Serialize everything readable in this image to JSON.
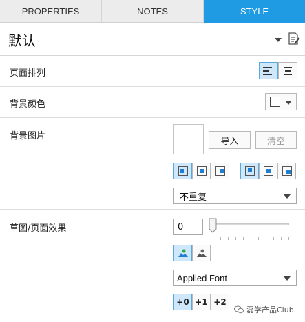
{
  "tabs": [
    {
      "label": "PROPERTIES",
      "active": false
    },
    {
      "label": "NOTES",
      "active": false
    },
    {
      "label": "STYLE",
      "active": true
    }
  ],
  "header": {
    "title": "默认"
  },
  "page_alignment": {
    "label": "页面排列",
    "options": [
      "align-left",
      "align-center"
    ],
    "selected": "align-left"
  },
  "bg_color": {
    "label": "背景颜色",
    "swatch": "#ffffff"
  },
  "bg_image": {
    "label": "背景图片",
    "import_label": "导入",
    "clear_label": "清空",
    "h_align": {
      "options": [
        "left",
        "center",
        "right"
      ],
      "selected": "left"
    },
    "v_align": {
      "options": [
        "top",
        "middle",
        "bottom"
      ],
      "selected": "top"
    },
    "repeat": "不重复"
  },
  "sketch": {
    "label": "草图/页面效果",
    "sketchiness": "0",
    "color_modes": {
      "options": [
        "color",
        "grayscale"
      ],
      "selected": "color"
    },
    "font": "Applied Font",
    "line_width": {
      "options": [
        "+0",
        "+1",
        "+2"
      ],
      "selected": "+0"
    }
  },
  "watermark": {
    "text": "磊学产品Club"
  },
  "accent_color": "#1e9be2"
}
